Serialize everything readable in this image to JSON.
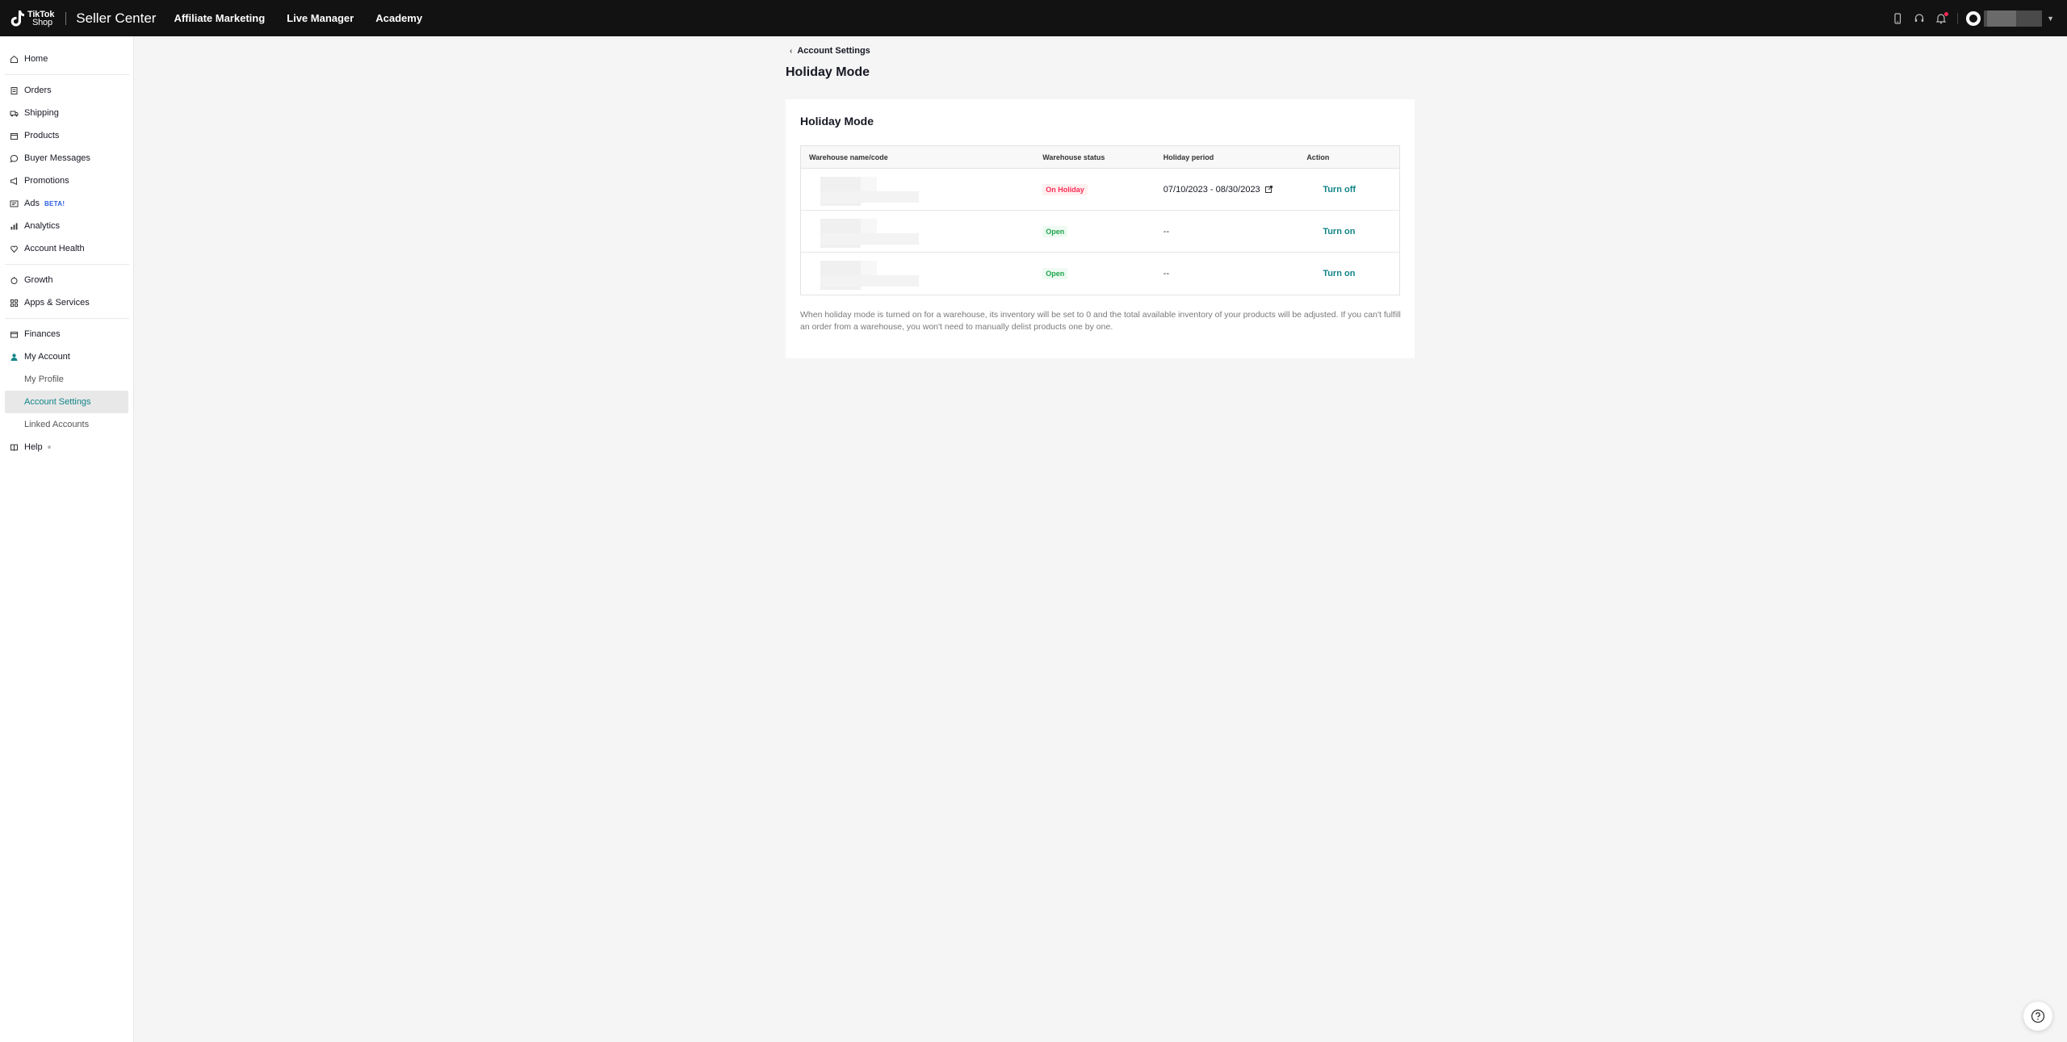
{
  "topbar": {
    "brand_line1": "TikTok",
    "brand_line2": "Shop",
    "app_name": "Seller Center",
    "nav": [
      "Affiliate Marketing",
      "Live Manager",
      "Academy"
    ]
  },
  "sidebar": {
    "home": "Home",
    "orders": "Orders",
    "shipping": "Shipping",
    "products": "Products",
    "buyer_messages": "Buyer Messages",
    "promotions": "Promotions",
    "ads": "Ads",
    "ads_badge": "BETA!",
    "analytics": "Analytics",
    "account_health": "Account Health",
    "growth": "Growth",
    "apps_services": "Apps & Services",
    "finances": "Finances",
    "my_account": "My Account",
    "my_profile": "My Profile",
    "account_settings": "Account Settings",
    "linked_accounts": "Linked Accounts",
    "help": "Help"
  },
  "main": {
    "breadcrumb": "Account Settings",
    "page_title": "Holiday Mode",
    "card_title": "Holiday Mode",
    "columns": [
      "Warehouse name/code",
      "Warehouse status",
      "Holiday period",
      "Action"
    ],
    "rows": [
      {
        "status": "On Holiday",
        "period": "07/10/2023 - 08/30/2023",
        "action": "Turn off"
      },
      {
        "status": "Open",
        "period": "--",
        "action": "Turn on"
      },
      {
        "status": "Open",
        "period": "--",
        "action": "Turn on"
      }
    ],
    "note": "When holiday mode is turned on for a warehouse, its inventory will be set to 0 and the total available inventory of your products will be adjusted. If you can't fulfill an order from a warehouse, you won't need to manually delist products one by one."
  },
  "colors": {
    "accent": "#128487",
    "topbar_bg": "#121212",
    "holiday_red": "#fe2c55",
    "open_green": "#1ea44b"
  }
}
